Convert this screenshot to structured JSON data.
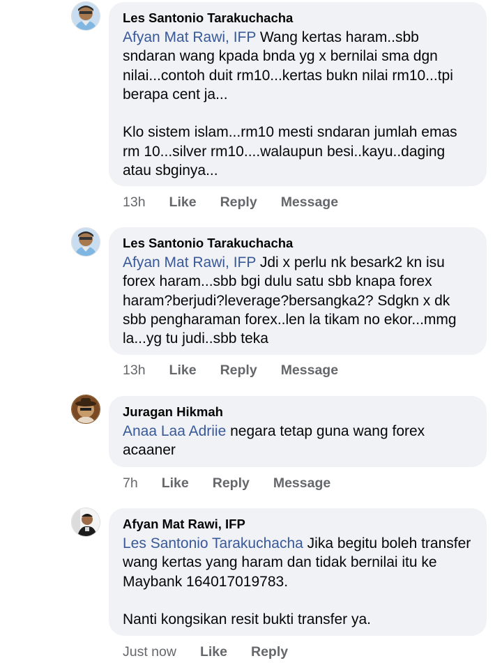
{
  "comments": [
    {
      "author": "Les Santonio Tarakuchacha",
      "mention": "Afyan Mat Rawi, IFP",
      "text": " Wang kertas haram..sbb sndaran wang kpada bnda yg x bernilai sma dgn nilai...contoh duit rm10...kertas bukn nilai rm10...tpi berapa cent ja...\n\nKlo sistem islam...rm10 mesti sndaran jumlah emas rm 10...silver rm10....walaupun besi..kayu..daging atau sbginya...",
      "time": "13h",
      "like": "Like",
      "reply": "Reply",
      "message": "Message",
      "avatar_icon": "cartoon-avatar-icon"
    },
    {
      "author": "Les Santonio Tarakuchacha",
      "mention": "Afyan Mat Rawi, IFP",
      "text": " Jdi x perlu nk besark2 kn isu forex haram...sbb bgi dulu satu sbb knapa forex haram?berjudi?leverage?bersangka2? Sdgkn x dk sbb pengharaman forex..len la tikam no ekor...mmg la...yg tu judi..sbb teka",
      "time": "13h",
      "like": "Like",
      "reply": "Reply",
      "message": "Message",
      "avatar_icon": "cartoon-avatar-icon"
    },
    {
      "author": "Juragan Hikmah",
      "mention": "Anaa Laa Adriie",
      "text": " negara tetap guna wang forex acaaner",
      "time": "7h",
      "like": "Like",
      "reply": "Reply",
      "message": "Message",
      "avatar_icon": "hat-person-avatar-icon"
    },
    {
      "author": "Afyan Mat Rawi, IFP",
      "mention": "Les Santonio Tarakuchacha",
      "text": " Jika begitu boleh transfer wang kertas yang haram dan  tidak bernilai itu ke Maybank 164017019783.\n\nNanti kongsikan resit bukti transfer ya.",
      "time": "Just now",
      "like": "Like",
      "reply": "Reply",
      "avatar_icon": "photo-avatar-icon"
    }
  ],
  "colors": {
    "bubble": "#f0f2f5",
    "mention": "#385898",
    "meta": "#65676b"
  }
}
